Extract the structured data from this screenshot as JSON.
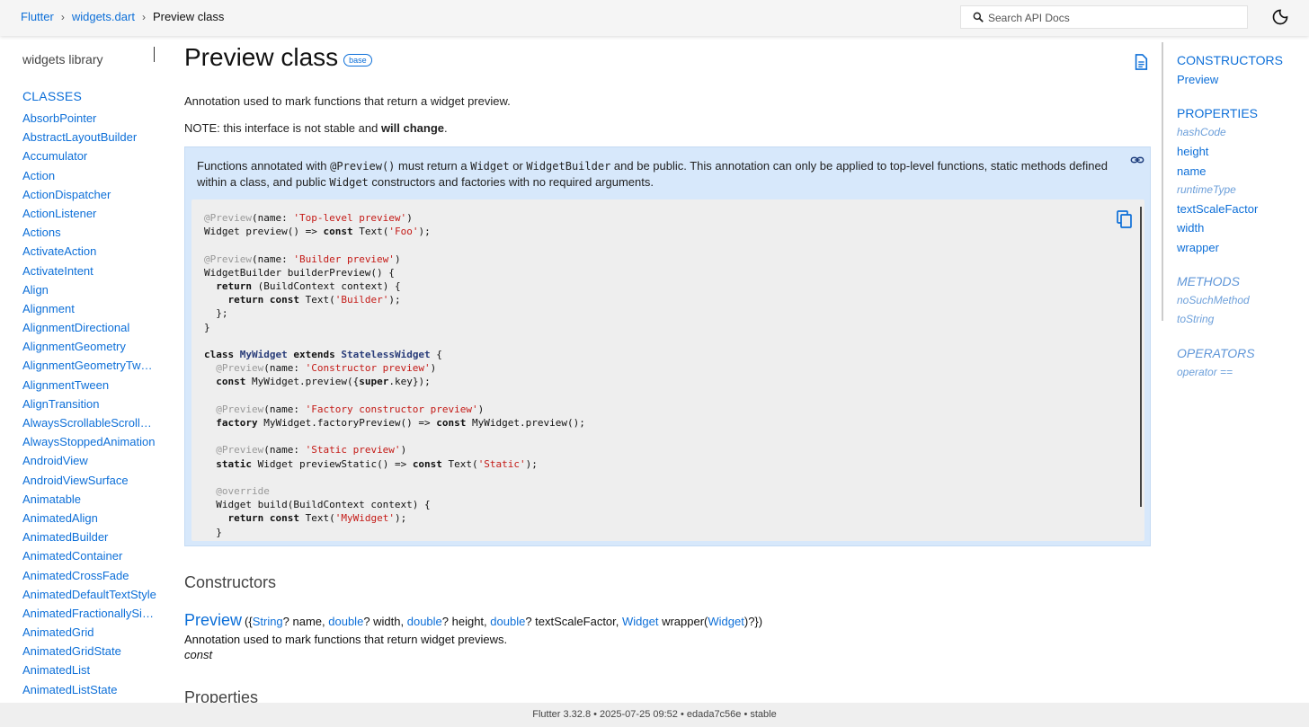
{
  "header": {
    "breadcrumb": [
      "Flutter",
      "widgets.dart",
      "Preview class"
    ],
    "search_placeholder": "Search API Docs"
  },
  "sidebar": {
    "library_title": "widgets library",
    "section": "CLASSES",
    "classes": [
      "AbsorbPointer",
      "AbstractLayoutBuilder",
      "Accumulator",
      "Action",
      "ActionDispatcher",
      "ActionListener",
      "Actions",
      "ActivateAction",
      "ActivateIntent",
      "Align",
      "Alignment",
      "AlignmentDirectional",
      "AlignmentGeometry",
      "AlignmentGeometryTwe…",
      "AlignmentTween",
      "AlignTransition",
      "AlwaysScrollableScrollPh…",
      "AlwaysStoppedAnimation",
      "AndroidView",
      "AndroidViewSurface",
      "Animatable",
      "AnimatedAlign",
      "AnimatedBuilder",
      "AnimatedContainer",
      "AnimatedCrossFade",
      "AnimatedDefaultTextStyle",
      "AnimatedFractionallySiz…",
      "AnimatedGrid",
      "AnimatedGridState",
      "AnimatedList",
      "AnimatedListState"
    ]
  },
  "main": {
    "title": "Preview class",
    "badge": "base",
    "intro": "Annotation used to mark functions that return a widget preview.",
    "note_prefix": "NOTE: this interface is not stable and ",
    "note_bold": "will change",
    "note_suffix": ".",
    "callout": {
      "t1": "Functions annotated with ",
      "c1": "@Preview()",
      "t2": " must return a ",
      "c2": "Widget",
      "t3": " or ",
      "c3": "WidgetBuilder",
      "t4": " and be public. This annotation can only be applied to top-level functions, static methods defined within a class, and public ",
      "c4": "Widget",
      "t5": " constructors and factories with no required arguments."
    },
    "constructors_heading": "Constructors",
    "ctor": {
      "name": "Preview",
      "p_open": "({",
      "t_string": "String",
      "p_name": "? name, ",
      "t_double1": "double",
      "p_width": "? width, ",
      "t_double2": "double",
      "p_height": "? height, ",
      "t_double3": "double",
      "p_tsf": "? textScaleFactor, ",
      "t_widget": "Widget",
      "p_wrapper": " wrapper(",
      "t_widget2": "Widget",
      "p_close": ")?})",
      "description": "Annotation used to mark functions that return widget previews.",
      "modifier": "const"
    },
    "properties_heading": "Properties"
  },
  "toc": {
    "constructors_head": "CONSTRUCTORS",
    "constructors": [
      "Preview"
    ],
    "properties_head": "PROPERTIES",
    "properties": [
      {
        "label": "hashCode",
        "inherited": true
      },
      {
        "label": "height",
        "inherited": false
      },
      {
        "label": "name",
        "inherited": false
      },
      {
        "label": "runtimeType",
        "inherited": true
      },
      {
        "label": "textScaleFactor",
        "inherited": false
      },
      {
        "label": "width",
        "inherited": false
      },
      {
        "label": "wrapper",
        "inherited": false
      }
    ],
    "methods_head": "METHODS",
    "methods": [
      "noSuchMethod",
      "toString"
    ],
    "operators_head": "OPERATORS",
    "operators": [
      "operator =="
    ]
  },
  "footer": "Flutter 3.32.8 • 2025-07-25 09:52 • edada7c56e • stable",
  "colors": {
    "accent": "#0d6fd8",
    "callout_bg": "#d7e8fb",
    "code_bg": "#eeeeee"
  },
  "icons": [
    "search-icon",
    "dark-mode-icon",
    "document-icon",
    "link-icon",
    "copy-icon"
  ]
}
